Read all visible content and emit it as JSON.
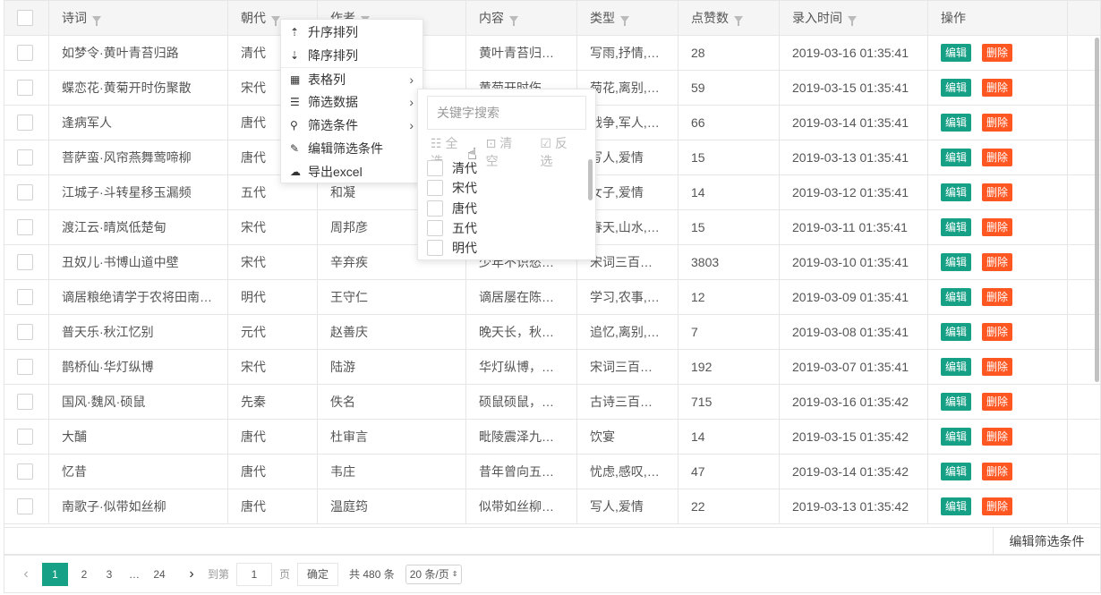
{
  "table": {
    "headers": [
      "诗词",
      "朝代",
      "作者",
      "内容",
      "类型",
      "点赞数",
      "录入时间",
      "操作"
    ],
    "edit_label": "编辑",
    "delete_label": "删除",
    "rows": [
      {
        "poem": "如梦令·黄叶青苔归路",
        "dynasty": "清代",
        "author": "",
        "content": "黄叶青苔归…",
        "type": "写雨,抒情,…",
        "likes": "28",
        "time": "2019-03-16 01:35:41"
      },
      {
        "poem": "蝶恋花·黄菊开时伤聚散",
        "dynasty": "宋代",
        "author": "",
        "content": "黄菊开时伤…",
        "type": "菊花,离别,…",
        "likes": "59",
        "time": "2019-03-15 01:35:41"
      },
      {
        "poem": "逢病军人",
        "dynasty": "唐代",
        "author": "",
        "content": "",
        "type": "战争,军人,…",
        "likes": "66",
        "time": "2019-03-14 01:35:41"
      },
      {
        "poem": "菩萨蛮·风帘燕舞莺啼柳",
        "dynasty": "唐代",
        "author": "",
        "content": "",
        "type": "写人,爱情",
        "likes": "15",
        "time": "2019-03-13 01:35:41"
      },
      {
        "poem": "江城子·斗转星移玉漏频",
        "dynasty": "五代",
        "author": "和凝",
        "content": "",
        "type": "女子,爱情",
        "likes": "14",
        "time": "2019-03-12 01:35:41"
      },
      {
        "poem": "渡江云·晴岚低楚甸",
        "dynasty": "宋代",
        "author": "周邦彦",
        "content": "",
        "type": "春天,山水,…",
        "likes": "15",
        "time": "2019-03-11 01:35:41"
      },
      {
        "poem": "丑奴儿·书博山道中壁",
        "dynasty": "宋代",
        "author": "辛弃疾",
        "content": "少年不识愁…",
        "type": "宋词三百…",
        "likes": "3803",
        "time": "2019-03-10 01:35:41"
      },
      {
        "poem": "谪居粮绝请学于农将田南…",
        "dynasty": "明代",
        "author": "王守仁",
        "content": "谪居屡在陈…",
        "type": "学习,农事,…",
        "likes": "12",
        "time": "2019-03-09 01:35:41"
      },
      {
        "poem": "普天乐·秋江忆别",
        "dynasty": "元代",
        "author": "赵善庆",
        "content": "晚天长，秋…",
        "type": "追忆,离别,…",
        "likes": "7",
        "time": "2019-03-08 01:35:41"
      },
      {
        "poem": "鹊桥仙·华灯纵博",
        "dynasty": "宋代",
        "author": "陆游",
        "content": "华灯纵博，…",
        "type": "宋词三百…",
        "likes": "192",
        "time": "2019-03-07 01:35:41"
      },
      {
        "poem": "国风·魏风·硕鼠",
        "dynasty": "先秦",
        "author": "佚名",
        "content": "硕鼠硕鼠，…",
        "type": "古诗三百…",
        "likes": "715",
        "time": "2019-03-16 01:35:42"
      },
      {
        "poem": "大酺",
        "dynasty": "唐代",
        "author": "杜审言",
        "content": "毗陵震泽九…",
        "type": "饮宴",
        "likes": "14",
        "time": "2019-03-15 01:35:42"
      },
      {
        "poem": "忆昔",
        "dynasty": "唐代",
        "author": "韦庄",
        "content": "昔年曾向五…",
        "type": "忧虑,感叹,…",
        "likes": "47",
        "time": "2019-03-14 01:35:42"
      },
      {
        "poem": "南歌子·似带如丝柳",
        "dynasty": "唐代",
        "author": "温庭筠",
        "content": "似带如丝柳…",
        "type": "写人,爱情",
        "likes": "22",
        "time": "2019-03-13 01:35:42"
      }
    ]
  },
  "footer": {
    "edit_filter_label": "编辑筛选条件"
  },
  "pager": {
    "prev": "‹",
    "pages": [
      "1",
      "2",
      "3",
      "…",
      "24"
    ],
    "next": "›",
    "goto_label": "到第",
    "goto_value": "1",
    "page_unit": "页",
    "confirm_label": "确定",
    "total_label": "共 480 条",
    "page_size": "20 条/页"
  },
  "menu": {
    "items": [
      {
        "icon": "sort-asc-icon",
        "label": "升序排列"
      },
      {
        "icon": "sort-desc-icon",
        "label": "降序排列"
      },
      {
        "icon": "table-icon",
        "label": "表格列"
      },
      {
        "icon": "list-icon",
        "label": "筛选数据"
      },
      {
        "icon": "filter-search-icon",
        "label": "筛选条件"
      },
      {
        "icon": "edit-icon",
        "label": "编辑筛选条件"
      },
      {
        "icon": "cloud-download-icon",
        "label": "导出excel"
      }
    ]
  },
  "submenu": {
    "search_placeholder": "关键字搜索",
    "select_all": "全选",
    "clear": "清空",
    "invert": "反选",
    "options": [
      "清代",
      "宋代",
      "唐代",
      "五代",
      "明代"
    ]
  },
  "colors": {
    "accent": "#16a085",
    "danger": "#ff5722"
  }
}
